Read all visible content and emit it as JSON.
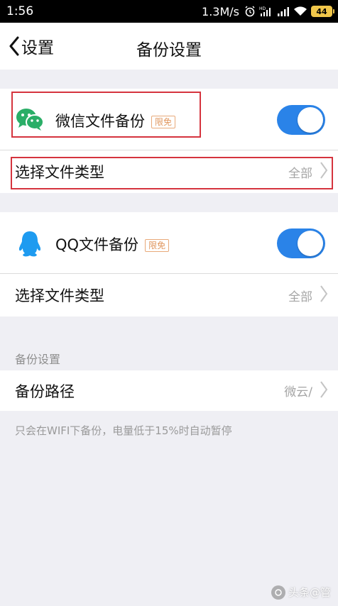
{
  "status_bar": {
    "time": "1:56",
    "speed": "1.3M/s",
    "battery": "44",
    "icons": [
      "alarm-icon",
      "hd-signal-icon",
      "signal-icon",
      "wifi-icon",
      "battery-icon"
    ]
  },
  "nav": {
    "back_label": "设置",
    "title": "备份设置"
  },
  "wechat": {
    "label": "微信文件备份",
    "badge": "限免",
    "toggle_on": true,
    "icon": "wechat-icon",
    "color": "#2aae67"
  },
  "wechat_types": {
    "label": "选择文件类型",
    "value": "全部"
  },
  "qq": {
    "label": "QQ文件备份",
    "badge": "限免",
    "toggle_on": true,
    "icon": "qq-penguin-icon",
    "color": "#1e9bf0"
  },
  "qq_types": {
    "label": "选择文件类型",
    "value": "全部"
  },
  "backup_section": {
    "header": "备份设置",
    "path_label": "备份路径",
    "path_value": "微云/"
  },
  "footnote": "只会在WIFI下备份，电量低于15%时自动暂停",
  "watermark": "头条@管",
  "colors": {
    "toggle_on": "#2a83e8",
    "badge": "#e0965e",
    "highlight": "#d5343e",
    "background": "#efeff4"
  }
}
